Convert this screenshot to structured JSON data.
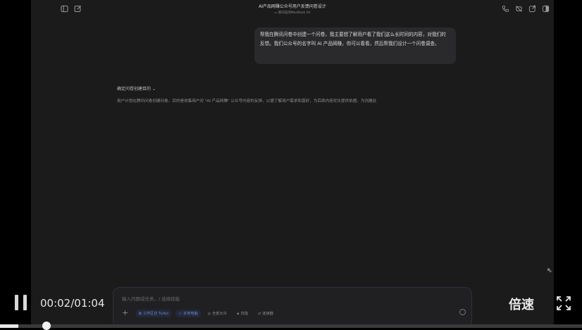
{
  "window": {
    "title": "AI产品网赚公众号用户反馈问卷设计",
    "subtitle": "新同志的MacBook Air"
  },
  "icons": {
    "left": [
      "sidebar-icon",
      "edit-icon"
    ],
    "right": [
      "phone-icon",
      "mute-icon",
      "share-icon",
      "panel-icon"
    ]
  },
  "chat": {
    "user_message": "帮我在腾讯问卷中创建一个问卷，我主要想了解用户看了我们这么长时间的内容，对我们的反馈。我们公众号的名字叫 AI 产品网赚，你可以看看，然后帮我们设计一个问卷调查。",
    "section_title": "确定问卷创建目的",
    "section_body": "用户计划在腾讯问卷创建问卷，目的是收集用户对 \"AI 产品网赚\" 公众号内容的反馈，以便了解用户需求和喜好，为后续内容优化提供依据。为创建此"
  },
  "composer": {
    "placeholder": "输入问题或任务，/ 选择技能",
    "chips": [
      {
        "label": "工作区切 Turbo",
        "active": true
      },
      {
        "label": "本地电脑",
        "active": true
      },
      {
        "label": "全部允许",
        "active": false
      },
      {
        "label": "技能",
        "active": false
      },
      {
        "label": "连接器",
        "active": false
      }
    ]
  },
  "player": {
    "time": "00:02/01:04",
    "speed_label": "倍速",
    "progress": 0.031
  }
}
